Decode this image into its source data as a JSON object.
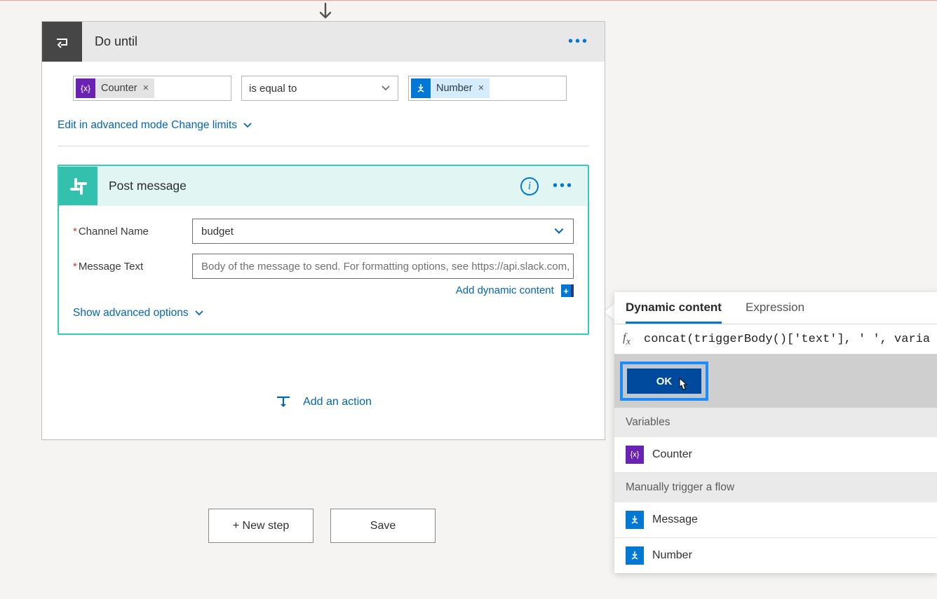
{
  "doUntil": {
    "title": "Do until",
    "condition": {
      "left": {
        "token": "Counter"
      },
      "operator": "is equal to",
      "right": {
        "token": "Number"
      }
    },
    "editAdvancedLabel": "Edit in advanced mode",
    "changeLimitsLabel": "Change limits"
  },
  "postMessage": {
    "title": "Post message",
    "fields": {
      "channel": {
        "label": "Channel Name",
        "value": "budget"
      },
      "message": {
        "label": "Message Text",
        "placeholder": "Body of the message to send. For formatting options, see https://api.slack.com,"
      }
    },
    "addDynamicLabel": "Add dynamic content",
    "showAdvancedLabel": "Show advanced options"
  },
  "addActionLabel": "Add an action",
  "buttons": {
    "newStep": "+ New step",
    "save": "Save"
  },
  "dynamicPanel": {
    "tabs": {
      "dynamic": "Dynamic content",
      "expression": "Expression"
    },
    "expressionText": "concat(triggerBody()['text'], ' ', varia",
    "okLabel": "OK",
    "sections": [
      {
        "title": "Variables",
        "items": [
          {
            "label": "Counter",
            "icon": "purple",
            "glyph": "{x}"
          }
        ]
      },
      {
        "title": "Manually trigger a flow",
        "items": [
          {
            "label": "Message",
            "icon": "blue",
            "glyph": "hand"
          },
          {
            "label": "Number",
            "icon": "blue",
            "glyph": "hand"
          }
        ]
      }
    ]
  }
}
